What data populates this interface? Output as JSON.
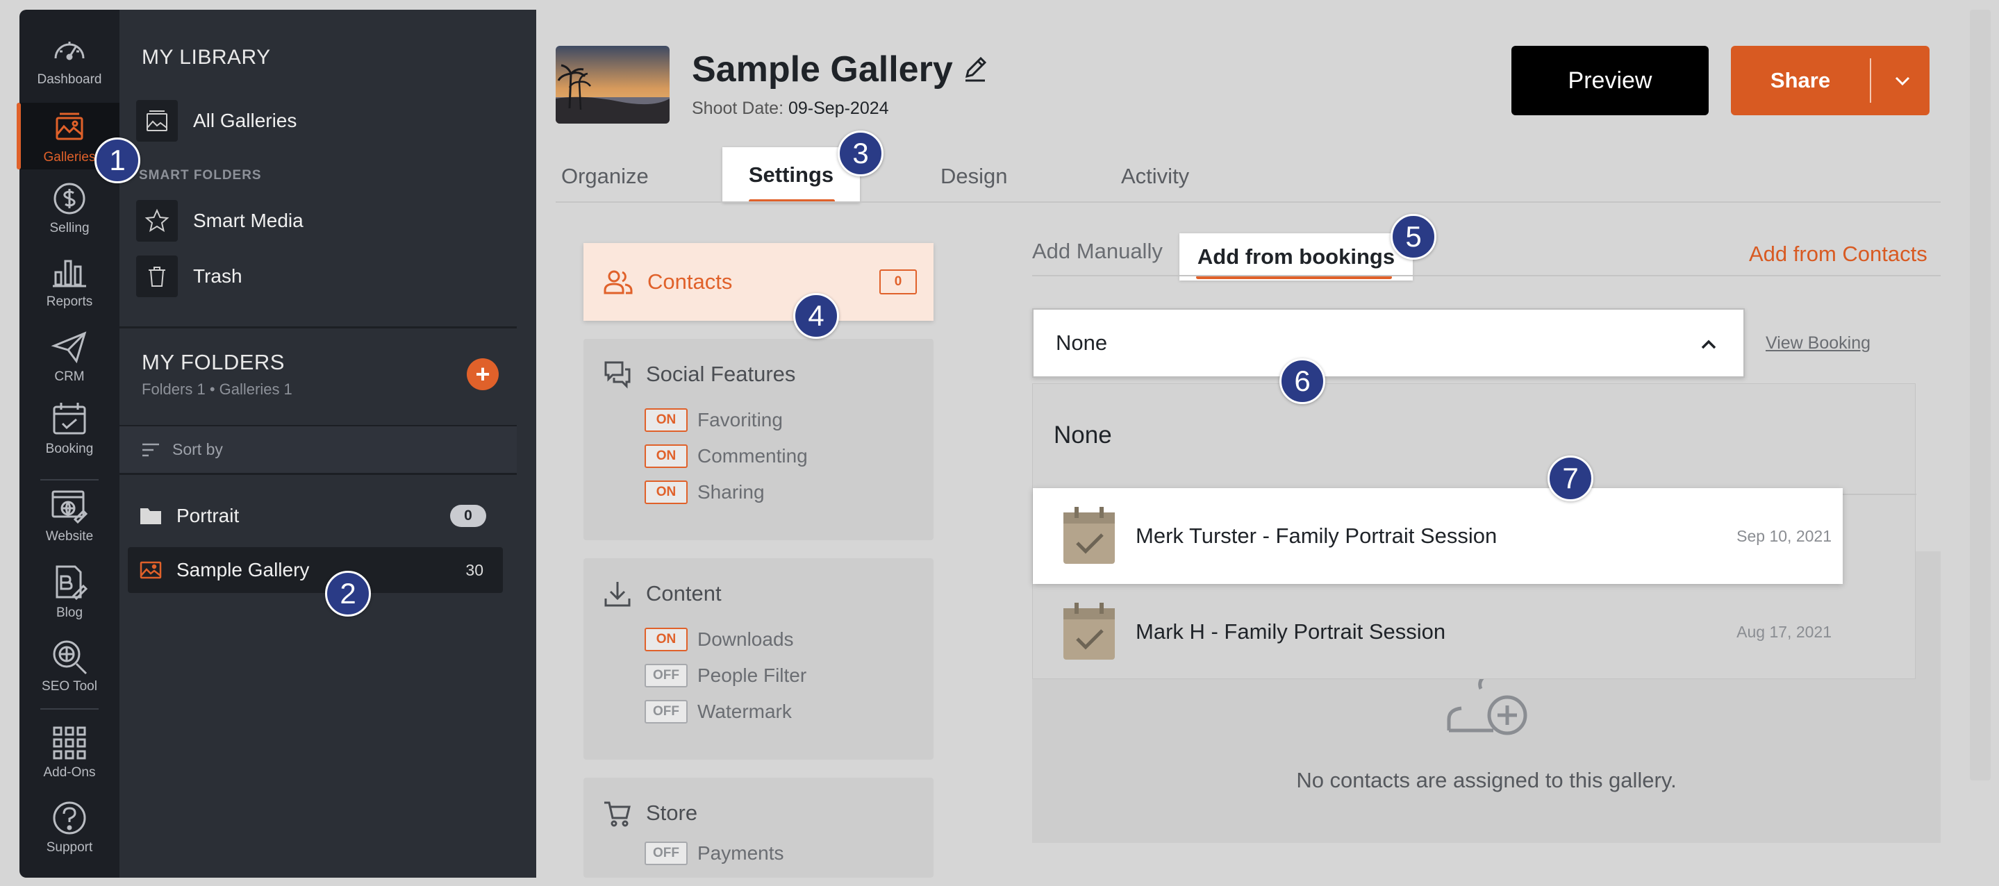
{
  "rail": {
    "items": [
      {
        "label": "Dashboard",
        "icon": "dashboard-icon"
      },
      {
        "label": "Galleries",
        "icon": "galleries-icon",
        "active": true
      },
      {
        "label": "Selling",
        "icon": "dollar-icon"
      },
      {
        "label": "Reports",
        "icon": "bar-chart-icon"
      },
      {
        "label": "CRM",
        "icon": "paper-plane-icon"
      },
      {
        "label": "Booking",
        "icon": "calendar-icon"
      },
      {
        "label": "Website",
        "icon": "website-icon"
      },
      {
        "label": "Blog",
        "icon": "blog-icon"
      },
      {
        "label": "SEO Tool",
        "icon": "seo-icon"
      },
      {
        "label": "Add-Ons",
        "icon": "grid-icon"
      },
      {
        "label": "Support",
        "icon": "help-icon"
      }
    ]
  },
  "library": {
    "heading": "MY LIBRARY",
    "all_galleries": "All Galleries",
    "smart_folders_heading": "SMART FOLDERS",
    "smart_media": "Smart Media",
    "trash": "Trash",
    "folders_heading": "MY FOLDERS",
    "folders_meta": "Folders 1 • Galleries 1",
    "sort_by": "Sort by",
    "folders": [
      {
        "name": "Portrait",
        "count": "0"
      },
      {
        "name": "Sample Gallery",
        "count": "30"
      }
    ]
  },
  "header": {
    "title": "Sample Gallery",
    "shoot_label": "Shoot Date:",
    "shoot_date": "09-Sep-2024",
    "preview_label": "Preview",
    "share_label": "Share"
  },
  "tabs": [
    "Organize",
    "Settings",
    "Design",
    "Activity"
  ],
  "settings": {
    "contacts": {
      "label": "Contacts",
      "count": "0"
    },
    "social": {
      "title": "Social Features",
      "options": [
        {
          "state": "ON",
          "label": "Favoriting"
        },
        {
          "state": "ON",
          "label": "Commenting"
        },
        {
          "state": "ON",
          "label": "Sharing"
        }
      ]
    },
    "content": {
      "title": "Content",
      "options": [
        {
          "state": "ON",
          "label": "Downloads"
        },
        {
          "state": "OFF",
          "label": "People Filter"
        },
        {
          "state": "OFF",
          "label": "Watermark"
        }
      ]
    },
    "store": {
      "title": "Store",
      "options": [
        {
          "state": "OFF",
          "label": "Payments"
        }
      ]
    }
  },
  "contacts_panel": {
    "tab_manual": "Add Manually",
    "tab_bookings": "Add from bookings",
    "add_from_contacts": "Add from Contacts",
    "select_value": "None",
    "view_booking": "View Booking",
    "dropdown_none": "None",
    "bookings": [
      {
        "name": "Merk Turster - Family Portrait Session",
        "date": "Sep 10, 2021"
      },
      {
        "name": "Mark H - Family Portrait Session",
        "date": "Aug 17, 2021"
      }
    ],
    "empty_text": "No contacts are assigned to this gallery."
  },
  "markers": [
    "1",
    "2",
    "3",
    "4",
    "5",
    "6",
    "7"
  ],
  "colors": {
    "accent": "#e0612a",
    "marker": "#2a3b86",
    "rail": "#1c1f25",
    "panel": "#2b2f36"
  }
}
